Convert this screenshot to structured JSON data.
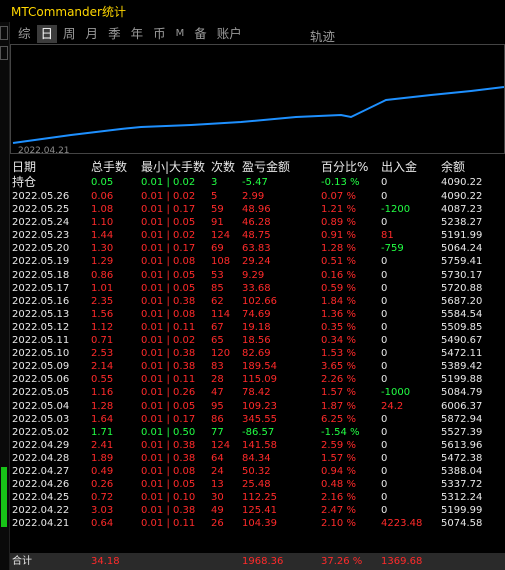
{
  "app": {
    "title": "MTCommander统计"
  },
  "tabs": [
    "综",
    "日",
    "周",
    "月",
    "季",
    "年",
    "币",
    "M",
    "备",
    "账户"
  ],
  "tab_active_index": 1,
  "tab_track": "轨迹",
  "chart": {
    "start_date": "2022.04.21"
  },
  "headers": [
    "日期",
    "总手数",
    "最小|大手数",
    "次数",
    "盈亏金额",
    "百分比%",
    "出入金",
    "余额"
  ],
  "position": {
    "date": "持仓",
    "lots": "0.05",
    "minmax": "0.01 | 0.02",
    "count": "3",
    "pnl": "-5.47",
    "pct": "-0.13 %",
    "flow": "0",
    "balance": "4090.22"
  },
  "rows": [
    [
      "2022.05.26",
      "0.06",
      "0.01 | 0.02",
      "5",
      "2.99",
      "0.07 %",
      "0",
      "4090.22"
    ],
    [
      "2022.05.25",
      "1.08",
      "0.01 | 0.17",
      "59",
      "48.96",
      "1.21 %",
      "-1200",
      "4087.23"
    ],
    [
      "2022.05.24",
      "1.10",
      "0.01 | 0.05",
      "91",
      "46.28",
      "0.89 %",
      "0",
      "5238.27"
    ],
    [
      "2022.05.23",
      "1.44",
      "0.01 | 0.02",
      "124",
      "48.75",
      "0.91 %",
      "81",
      "5191.99"
    ],
    [
      "2022.05.20",
      "1.30",
      "0.01 | 0.17",
      "69",
      "63.83",
      "1.28 %",
      "-759",
      "5064.24"
    ],
    [
      "2022.05.19",
      "1.29",
      "0.01 | 0.08",
      "108",
      "29.24",
      "0.51 %",
      "0",
      "5759.41"
    ],
    [
      "2022.05.18",
      "0.86",
      "0.01 | 0.05",
      "53",
      "9.29",
      "0.16 %",
      "0",
      "5730.17"
    ],
    [
      "2022.05.17",
      "1.01",
      "0.01 | 0.05",
      "85",
      "33.68",
      "0.59 %",
      "0",
      "5720.88"
    ],
    [
      "2022.05.16",
      "2.35",
      "0.01 | 0.38",
      "62",
      "102.66",
      "1.84 %",
      "0",
      "5687.20"
    ],
    [
      "2022.05.13",
      "1.56",
      "0.01 | 0.08",
      "114",
      "74.69",
      "1.36 %",
      "0",
      "5584.54"
    ],
    [
      "2022.05.12",
      "1.12",
      "0.01 | 0.11",
      "67",
      "19.18",
      "0.35 %",
      "0",
      "5509.85"
    ],
    [
      "2022.05.11",
      "0.71",
      "0.01 | 0.02",
      "65",
      "18.56",
      "0.34 %",
      "0",
      "5490.67"
    ],
    [
      "2022.05.10",
      "2.53",
      "0.01 | 0.38",
      "120",
      "82.69",
      "1.53 %",
      "0",
      "5472.11"
    ],
    [
      "2022.05.09",
      "2.14",
      "0.01 | 0.38",
      "83",
      "189.54",
      "3.65 %",
      "0",
      "5389.42"
    ],
    [
      "2022.05.06",
      "0.55",
      "0.01 | 0.11",
      "28",
      "115.09",
      "2.26 %",
      "0",
      "5199.88"
    ],
    [
      "2022.05.05",
      "1.16",
      "0.01 | 0.26",
      "47",
      "78.42",
      "1.57 %",
      "-1000",
      "5084.79"
    ],
    [
      "2022.05.04",
      "1.28",
      "0.01 | 0.05",
      "95",
      "109.23",
      "1.87 %",
      "24.2",
      "6006.37"
    ],
    [
      "2022.05.03",
      "1.64",
      "0.01 | 0.17",
      "86",
      "345.55",
      "6.25 %",
      "0",
      "5872.94"
    ],
    [
      "2022.05.02",
      "1.71",
      "0.01 | 0.50",
      "77",
      "-86.57",
      "-1.54 %",
      "0",
      "5527.39"
    ],
    [
      "2022.04.29",
      "2.41",
      "0.01 | 0.38",
      "124",
      "141.58",
      "2.59 %",
      "0",
      "5613.96"
    ],
    [
      "2022.04.28",
      "1.89",
      "0.01 | 0.38",
      "64",
      "84.34",
      "1.57 %",
      "0",
      "5472.38"
    ],
    [
      "2022.04.27",
      "0.49",
      "0.01 | 0.08",
      "24",
      "50.32",
      "0.94 %",
      "0",
      "5388.04"
    ],
    [
      "2022.04.26",
      "0.26",
      "0.01 | 0.05",
      "13",
      "25.48",
      "0.48 %",
      "0",
      "5337.72"
    ],
    [
      "2022.04.25",
      "0.72",
      "0.01 | 0.10",
      "30",
      "112.25",
      "2.16 %",
      "0",
      "5312.24"
    ],
    [
      "2022.04.22",
      "3.03",
      "0.01 | 0.38",
      "49",
      "125.41",
      "2.47 %",
      "0",
      "5199.99"
    ],
    [
      "2022.04.21",
      "0.64",
      "0.01 | 0.11",
      "26",
      "104.39",
      "2.10 %",
      "4223.48",
      "5074.58"
    ]
  ],
  "total": {
    "label": "合计",
    "lots": "34.18",
    "pnl": "1968.36",
    "pct": "37.26 %",
    "flow": "1369.68"
  },
  "colors": {
    "accent": "#ffd700",
    "up": "#ff2a2a",
    "down": "#22ff44",
    "line": "#1e90ff"
  }
}
